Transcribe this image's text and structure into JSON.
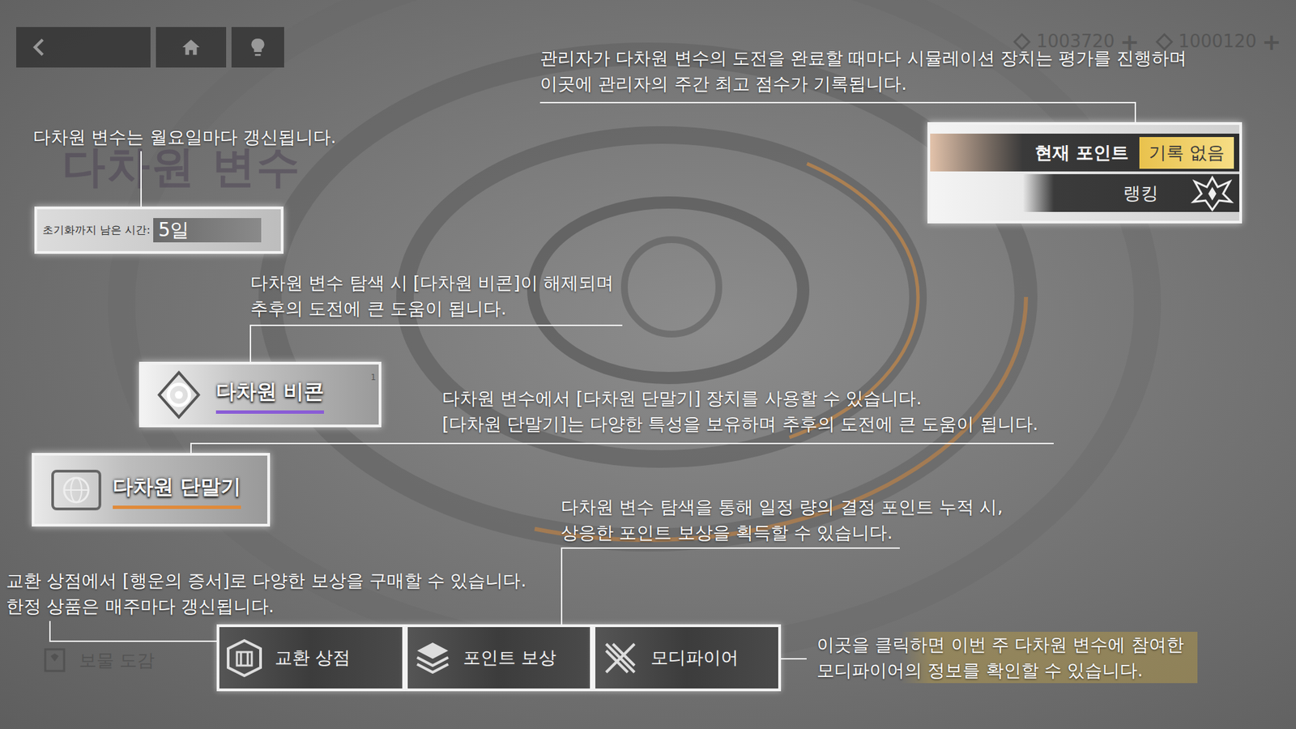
{
  "currencies": [
    {
      "value": "1003720",
      "plus": "+"
    },
    {
      "value": "1000120",
      "plus": "+"
    }
  ],
  "title": "다차원 변수",
  "reset": {
    "label": "초기화까지 남은 시간:",
    "value": "5일"
  },
  "points": {
    "label": "현재 포인트",
    "value": "기록 없음",
    "ranking": "랭킹"
  },
  "beacon": {
    "label": "다차원 비콘",
    "badge": "1"
  },
  "terminal": {
    "label": "다차원 단말기"
  },
  "bottom_bar": [
    {
      "label": "교환 상점"
    },
    {
      "label": "포인트 보상"
    },
    {
      "label": "모디파이어"
    }
  ],
  "collection": {
    "label": "보물 도감"
  },
  "tips": [
    {
      "lines": [
        "다차원 변수는 월요일마다 갱신됩니다."
      ]
    },
    {
      "lines": [
        "관리자가 다차원 변수의 도전을 완료할 때마다 시뮬레이션 장치는 평가를 진행하며",
        "이곳에 관리자의 주간 최고 점수가 기록됩니다."
      ]
    },
    {
      "lines": [
        "다차원 변수 탐색 시 [다차원 비콘]이 해제되며",
        "추후의 도전에 큰 도움이 됩니다."
      ]
    },
    {
      "lines": [
        "다차원 변수에서 [다차원 단말기] 장치를 사용할 수 있습니다.",
        "[다차원 단말기]는 다양한 특성을 보유하며 추후의 도전에 큰 도움이 됩니다."
      ]
    },
    {
      "lines": [
        "다차원 변수 탐색을 통해 일정 량의 결정 포인트 누적 시,",
        "상응한 포인트 보상을 획득할 수 있습니다."
      ]
    },
    {
      "lines": [
        "교환 상점에서 [행운의 증서]로 다양한 보상을 구매할 수 있습니다.",
        "한정 상품은 매주마다 갱신됩니다."
      ]
    },
    {
      "lines": [
        "이곳을 클릭하면 이번 주 다차원 변수에 참여한",
        "모디파이어의 정보를 확인할 수 있습니다."
      ]
    }
  ]
}
